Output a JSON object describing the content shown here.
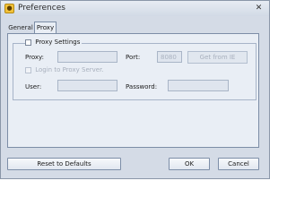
{
  "window": {
    "title": "Preferences",
    "icon": "app-icon"
  },
  "tabs": [
    {
      "label": "General",
      "selected": false
    },
    {
      "label": "Proxy",
      "selected": true
    }
  ],
  "proxy": {
    "group_label": "Proxy Settings",
    "proxy_label": "Proxy:",
    "proxy_value": "",
    "port_label": "Port:",
    "port_value": "8080",
    "get_from_ie_label": "Get from IE",
    "login_label": "Login to Proxy Server.",
    "user_label": "User:",
    "user_value": "",
    "password_label": "Password:",
    "password_value": ""
  },
  "buttons": {
    "reset": "Reset to Defaults",
    "ok": "OK",
    "cancel": "Cancel"
  }
}
